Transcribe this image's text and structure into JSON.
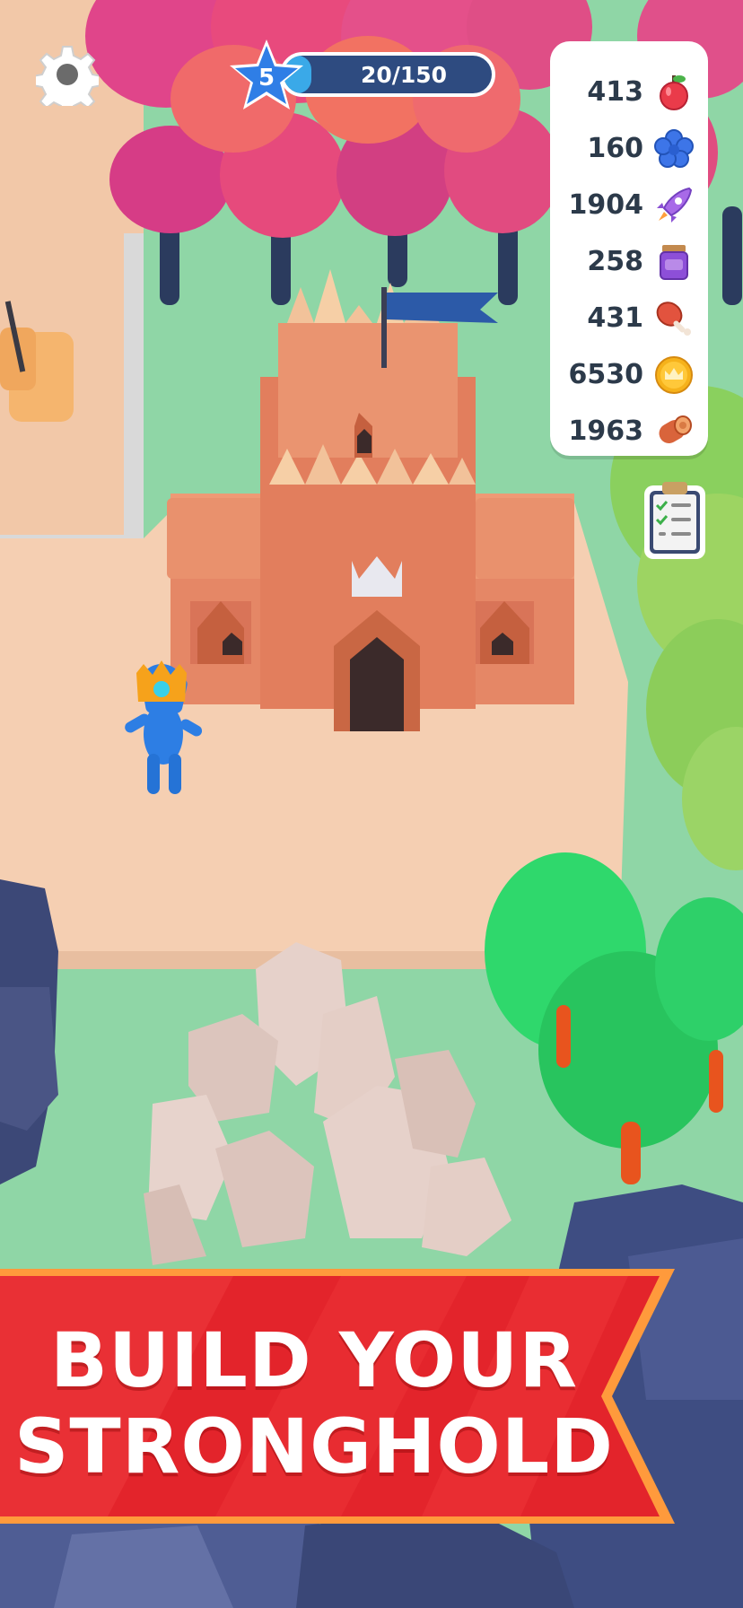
{
  "hud": {
    "level": "5",
    "xp_text": "20/150",
    "xp_progress": 0.1333
  },
  "resources": [
    {
      "value": "413",
      "icon": "apple-icon"
    },
    {
      "value": "160",
      "icon": "blue-flower-icon"
    },
    {
      "value": "1904",
      "icon": "rocket-icon"
    },
    {
      "value": "258",
      "icon": "jam-jar-icon"
    },
    {
      "value": "431",
      "icon": "meat-leg-icon"
    },
    {
      "value": "6530",
      "icon": "crown-coin-icon"
    },
    {
      "value": "1963",
      "icon": "wood-log-icon"
    }
  ],
  "banner": {
    "line1": "BUILD YOUR",
    "line2": "STRONGHOLD"
  },
  "colors": {
    "banner_red": "#e3242b",
    "banner_orange": "#ff9a3c",
    "xp_bar_bg": "#2e4b80",
    "xp_fill": "#3aa9e8",
    "level_star": "#2f7ee6"
  }
}
